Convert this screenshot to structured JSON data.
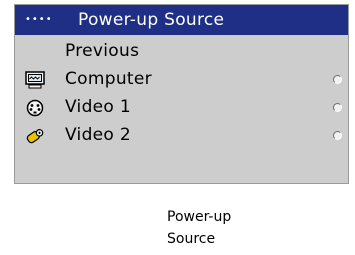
{
  "menu": {
    "title": "Power-up Source",
    "dots": "••••",
    "items": [
      {
        "label": "Previous",
        "icon": null,
        "radio": false
      },
      {
        "label": "Computer",
        "icon": "computer-monitor-icon",
        "radio": true
      },
      {
        "label": "Video 1",
        "icon": "svideo-connector-icon",
        "radio": true
      },
      {
        "label": "Video 2",
        "icon": "composite-rca-connector-icon",
        "radio": true
      }
    ]
  },
  "caption": {
    "line1": "Power-up",
    "line2": "Source"
  },
  "colors": {
    "header_bg": "#1f2f86",
    "menu_bg": "#cdcdcd",
    "header_text": "#ffffff",
    "item_text": "#000000"
  }
}
